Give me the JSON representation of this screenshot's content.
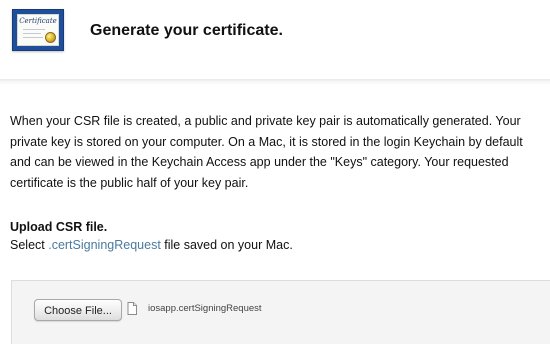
{
  "header": {
    "title": "Generate your certificate.",
    "icon": "certificate-icon",
    "icon_text": "Certificate"
  },
  "description": "When your CSR file is created, a public and private key pair is automatically generated. Your private key is stored on your computer. On a Mac, it is stored in the login Keychain by default and can be viewed in the Keychain Access app under the \"Keys\" category. Your requested certificate is the public half of your key pair.",
  "upload": {
    "heading": "Upload CSR file.",
    "instruction_prefix": "Select ",
    "instruction_extension": ".certSigningRequest",
    "instruction_suffix": " file saved on your Mac.",
    "choose_file_label": "Choose File...",
    "selected_file_name": "iosapp.certSigningRequest",
    "file_icon": "document-icon"
  },
  "colors": {
    "icon_blue": "#1f4e9a",
    "seal_gold": "#d8b32c",
    "file_extension_blue": "#4a7aa0",
    "panel_background": "#f4f4f4"
  }
}
